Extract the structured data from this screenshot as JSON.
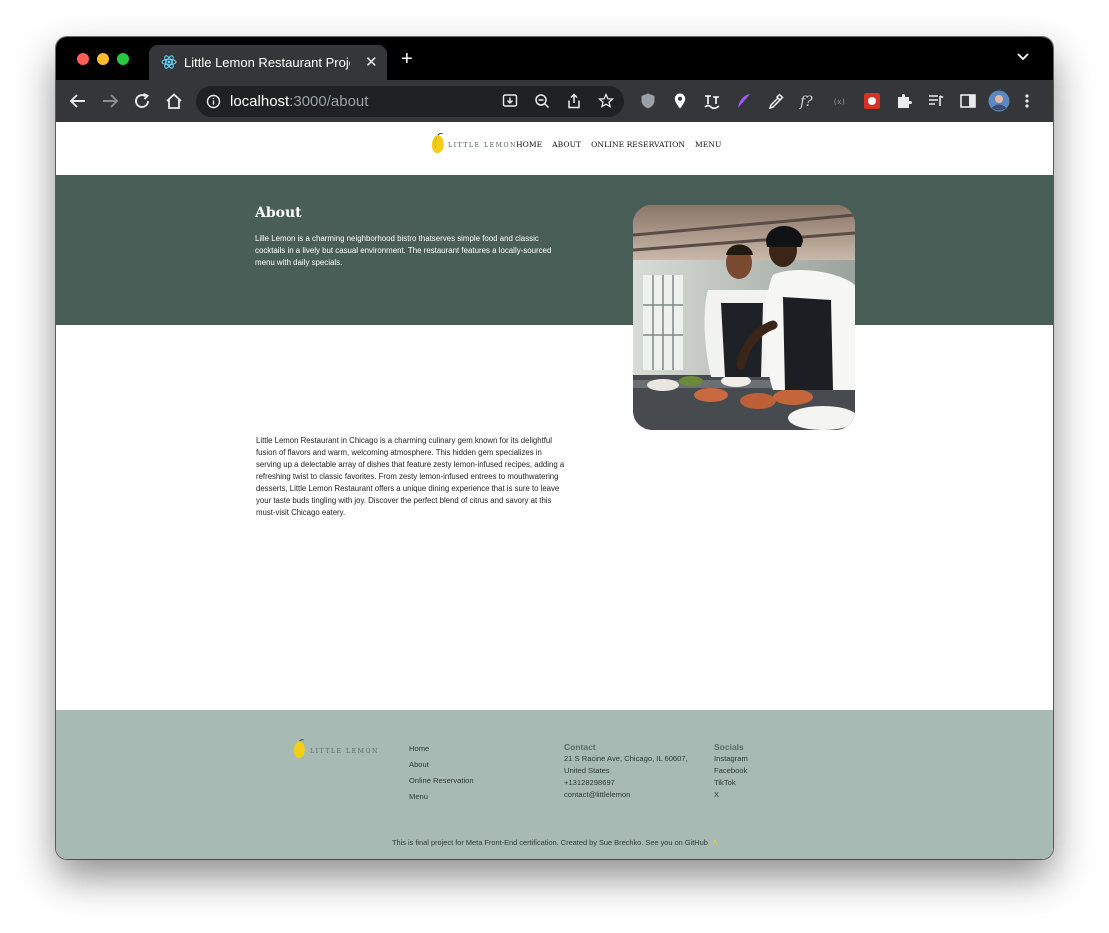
{
  "browser": {
    "tab_title": "Little Lemon Restaurant Project",
    "url_host": "localhost",
    "url_path": ":3000/about",
    "new_tab_label": "+",
    "close_tab_label": "✕"
  },
  "nav": {
    "logo_text": "LITTLE LEMON",
    "links": [
      "HOME",
      "ABOUT",
      "ONLINE RESERVATION",
      "MENU"
    ]
  },
  "hero": {
    "title": "About",
    "text": "Lille Lemon is a charming neighborhood bistro thatserves simple food and classic cocktails in a lively but casual environment. The restaurant features a locally-sourced menu with daily specials."
  },
  "about": {
    "body": "Little Lemon Restaurant in Chicago is a charming culinary gem known for its delightful fusion of flavors and warm, welcoming atmosphere. This hidden gem specializes in serving up a delectable array of dishes that feature zesty lemon-infused recipes, adding a refreshing twist to classic favorites. From zesty lemon-infused entrees to mouthwatering desserts, Little Lemon Restaurant offers a unique dining experience that is sure to leave your taste buds tingling with joy. Discover the perfect blend of citrus and savory at this must-visit Chicago eatery."
  },
  "footer": {
    "logo_text": "LITTLE LEMON",
    "nav_links": [
      "Home",
      "About",
      "Online Reservation",
      "Menu"
    ],
    "contact": {
      "heading": "Contact",
      "address_1": "21 S Racine Ave, Chicago, IL 60607,",
      "address_2": "United States",
      "phone": "+13128298697",
      "email": "contact@littlelemon"
    },
    "socials": {
      "heading": "Socials",
      "links": [
        "Instagram",
        "Facebook",
        "TikTok",
        "X"
      ]
    },
    "credit_text": "This is final project for Meta Front-End certification. Created by Sue Brechko. See you on GitHub",
    "credit_icon": "/\\"
  },
  "colors": {
    "brand_green": "#495e57",
    "footer_bg": "#a7bab3",
    "lemon_yellow": "#f4ce14"
  }
}
